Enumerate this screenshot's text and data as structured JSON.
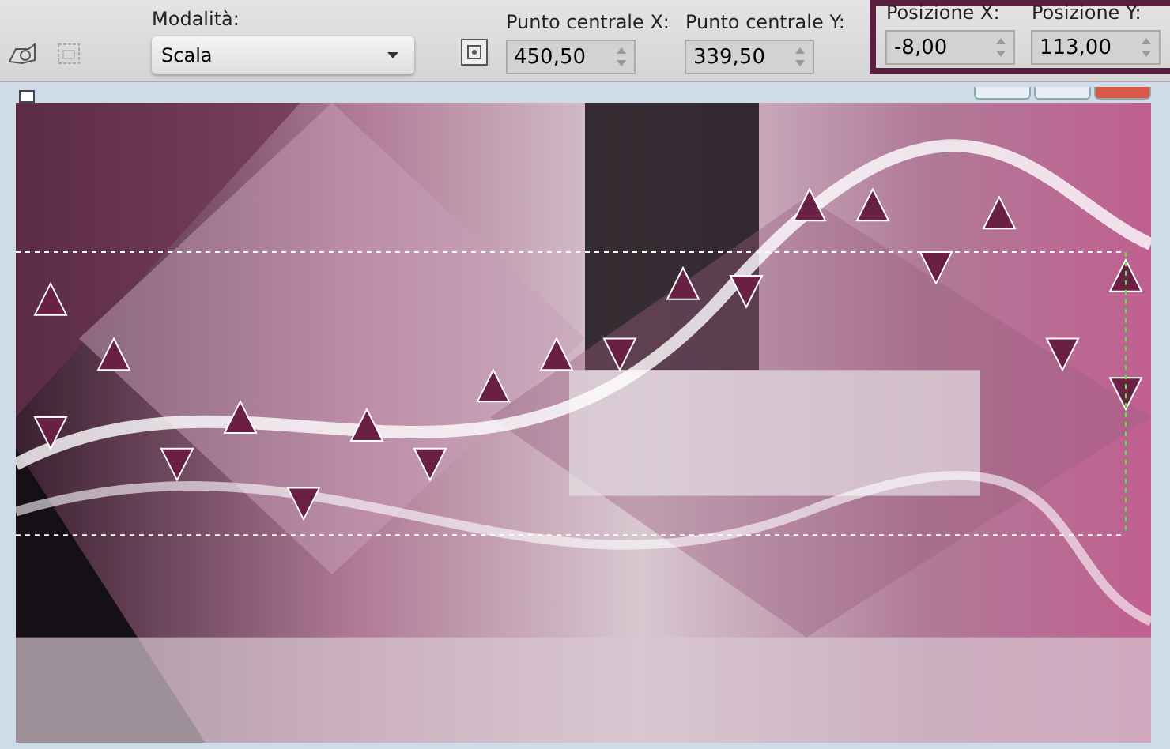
{
  "toolbar": {
    "mode": {
      "label": "Modalità:",
      "value": "Scala"
    },
    "center_fields": [
      {
        "label": "Punto centrale X:",
        "value": "450,50"
      },
      {
        "label": "Punto centrale Y:",
        "value": "339,50"
      }
    ],
    "position_group": {
      "highlighted": true,
      "fields": [
        {
          "label": "Posizione X:",
          "value": "-8,00"
        },
        {
          "label": "Posizione Y:",
          "value": "113,00"
        }
      ]
    }
  }
}
